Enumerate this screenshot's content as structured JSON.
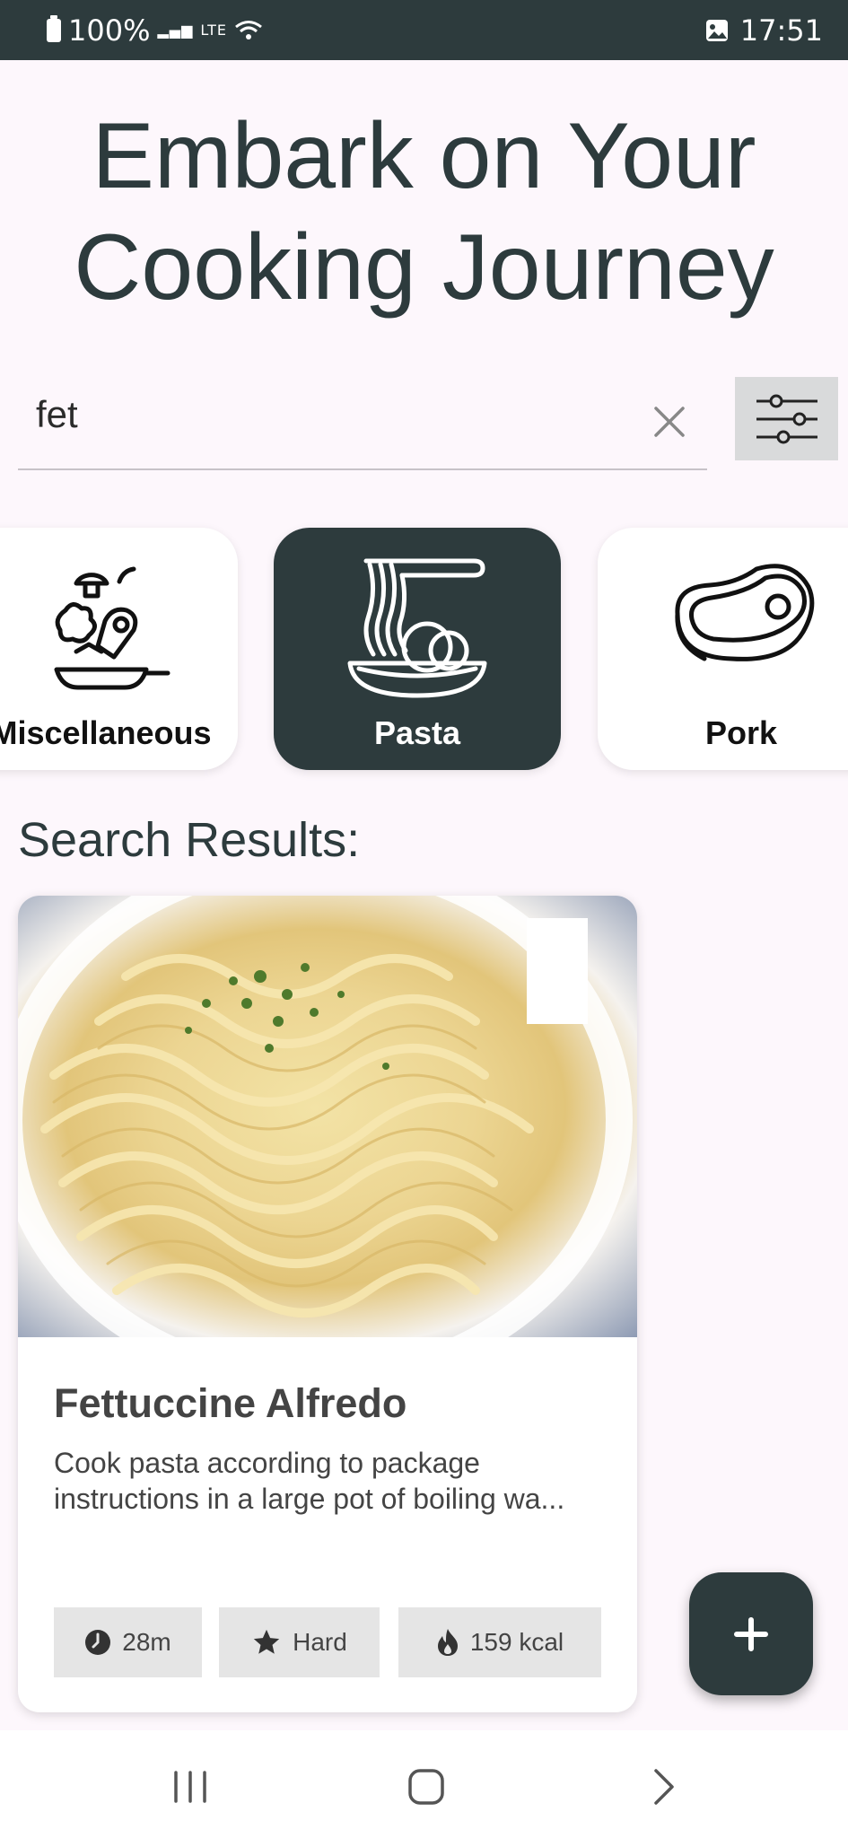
{
  "status_bar": {
    "battery": "100%",
    "network": "LTE",
    "time": "17:51"
  },
  "header": {
    "title_line1": "Embark on Your",
    "title_line2": "Cooking Journey"
  },
  "search": {
    "value": "fet"
  },
  "categories": [
    {
      "label": "Miscellaneous",
      "icon": "cooking-pan-icon",
      "selected": false
    },
    {
      "label": "Pasta",
      "icon": "pasta-bowl-icon",
      "selected": true
    },
    {
      "label": "Pork",
      "icon": "meat-steak-icon",
      "selected": false
    }
  ],
  "results": {
    "heading": "Search Results:",
    "items": [
      {
        "title": "Fettuccine Alfredo",
        "description": "Cook pasta according to package instructions in a large pot of boiling wa...",
        "time": "28m",
        "difficulty": "Hard",
        "calories": "159 kcal",
        "image": "fettuccine-photo"
      }
    ]
  },
  "colors": {
    "primary": "#2d3b3d",
    "background": "#fdf7fc",
    "chip": "#e5e5e5"
  }
}
